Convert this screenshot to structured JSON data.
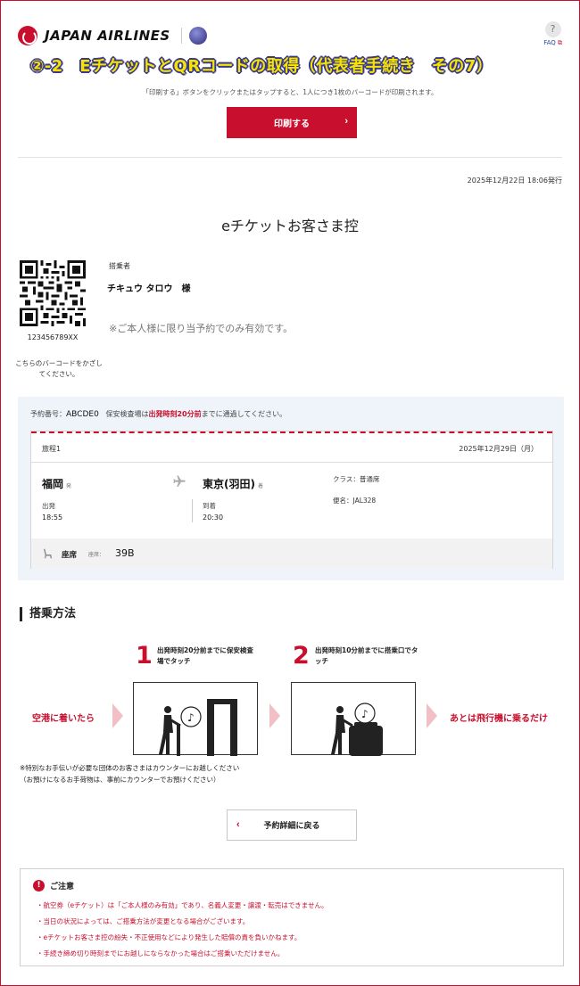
{
  "header": {
    "brand": "JAPAN AIRLINES",
    "faq_label": "FAQ",
    "faq_symbol": "?"
  },
  "overlay_title": "②-2　EチケットとQRコードの取得（代表者手続き　その7）",
  "print_section": {
    "note": "「印刷する」ボタンをクリックまたはタップすると、1人につき1枚のバーコードが印刷されます。",
    "button_label": "印刷する"
  },
  "ticket": {
    "issued": "2025年12月22日 18:06発行",
    "title": "eチケットお客さま控",
    "barcode_number": "123456789XX",
    "barcode_note": "こちらのバーコードをかざしてください。",
    "passenger_label": "搭乗者",
    "passenger_name": "チキュウ タロウ　様",
    "validity_note": "※ご本人様に限り当予約でのみ有効です。"
  },
  "reservation": {
    "label": "予約番号：",
    "code": "ABCDE0",
    "security_pre": "保安検査場は",
    "security_time": "出発時刻20分前",
    "security_post": "までに通過してください。",
    "trip_label": "旅程1",
    "trip_date": "2025年12月29日（月）",
    "origin": "福岡",
    "origin_tag": "発",
    "destination": "東京(羽田)",
    "destination_tag": "着",
    "departure_label": "出発",
    "departure_time": "18:55",
    "arrival_label": "到着",
    "arrival_time": "20:30",
    "class_info": "クラス：普通席",
    "flight_info": "便名：JAL328",
    "seat_label": "座席",
    "seat_sublabel": "座席：",
    "seat_value": "39B"
  },
  "boarding": {
    "heading": "搭乗方法",
    "step1_num": "1",
    "step1_text": "出発時刻20分前までに保安検査場でタッチ",
    "step2_num": "2",
    "step2_text": "出発時刻10分前までに搭乗口でタッチ",
    "start_text": "空港に着いたら",
    "end_text": "あとは飛行機に乗るだけ",
    "note_line1": "※特別なお手伝いが必要な団体のお客さまはカウンターにお越しください",
    "note_line2": "（お預けになるお手荷物は、事前にカウンターでお預けください）"
  },
  "back_button_label": "予約詳細に戻る",
  "caution": {
    "title": "ご注意",
    "items": [
      "航空券（eチケット）は「ご本人様のみ有効」であり、名義人変更・譲渡・転売はできません。",
      "当日の状況によっては、ご搭乗方法が変更となる場合がございます。",
      "eチケットお客さま控の紛失・不正使用などにより発生した賠償の責を負いかねます。",
      "手続き締め切り時刻までにお越しにならなかった場合はご搭乗いただけません。"
    ]
  },
  "colors": {
    "accent": "#c8102e",
    "panel_bg": "#eef4fa",
    "overlay_text": "#f7e300"
  }
}
